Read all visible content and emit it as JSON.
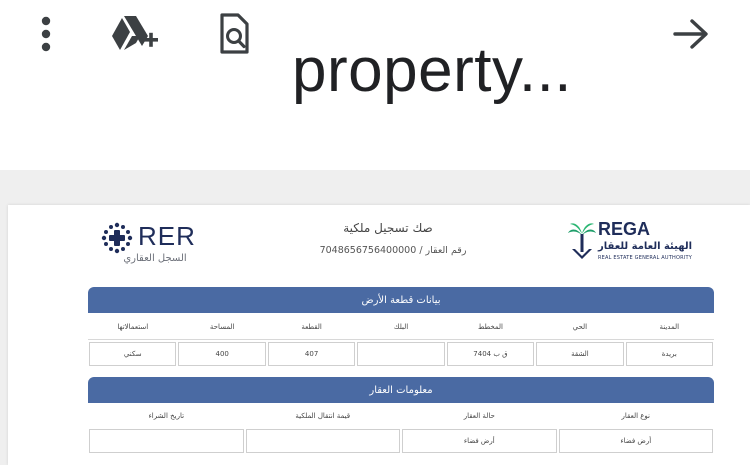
{
  "toolbar": {
    "title": "property...",
    "icons": {
      "more": "more-vert-icon",
      "drive": "add-to-drive-icon",
      "find": "find-in-document-icon",
      "forward": "arrow-forward-icon"
    }
  },
  "document": {
    "title": "صك تسجيل ملكية",
    "number_label": "رقم العقار /",
    "number_value": "7048656756400000",
    "rer": {
      "name": "RER",
      "subtitle": "السجل العقاري"
    },
    "rega": {
      "name": "REGA",
      "arabic": "الهيئة العامة للعقار",
      "english": "REAL ESTATE GENERAL AUTHORITY"
    },
    "section1": {
      "title": "بيانات قطعة الأرض",
      "headers": [
        "المدينة",
        "الحي",
        "المخطط",
        "البلك",
        "القطعة",
        "المساحة",
        "استعمالاتها"
      ],
      "values": [
        "بريدة",
        "الشقة",
        "ق ب 7404",
        "",
        "407",
        "400",
        "سكني"
      ]
    },
    "section2": {
      "title": "معلومات العقار",
      "headers": [
        "نوع العقار",
        "حالة العقار",
        "قيمة انتقال الملكية",
        "تاريخ الشراء"
      ],
      "values": [
        "أرض فضاء",
        "أرض فضاء",
        "",
        ""
      ]
    }
  },
  "colors": {
    "section_header": "#4a6aa3",
    "viewer_bg": "#efefef",
    "brand_navy": "#1f2d5a",
    "rega_green": "#1e9e6a"
  }
}
